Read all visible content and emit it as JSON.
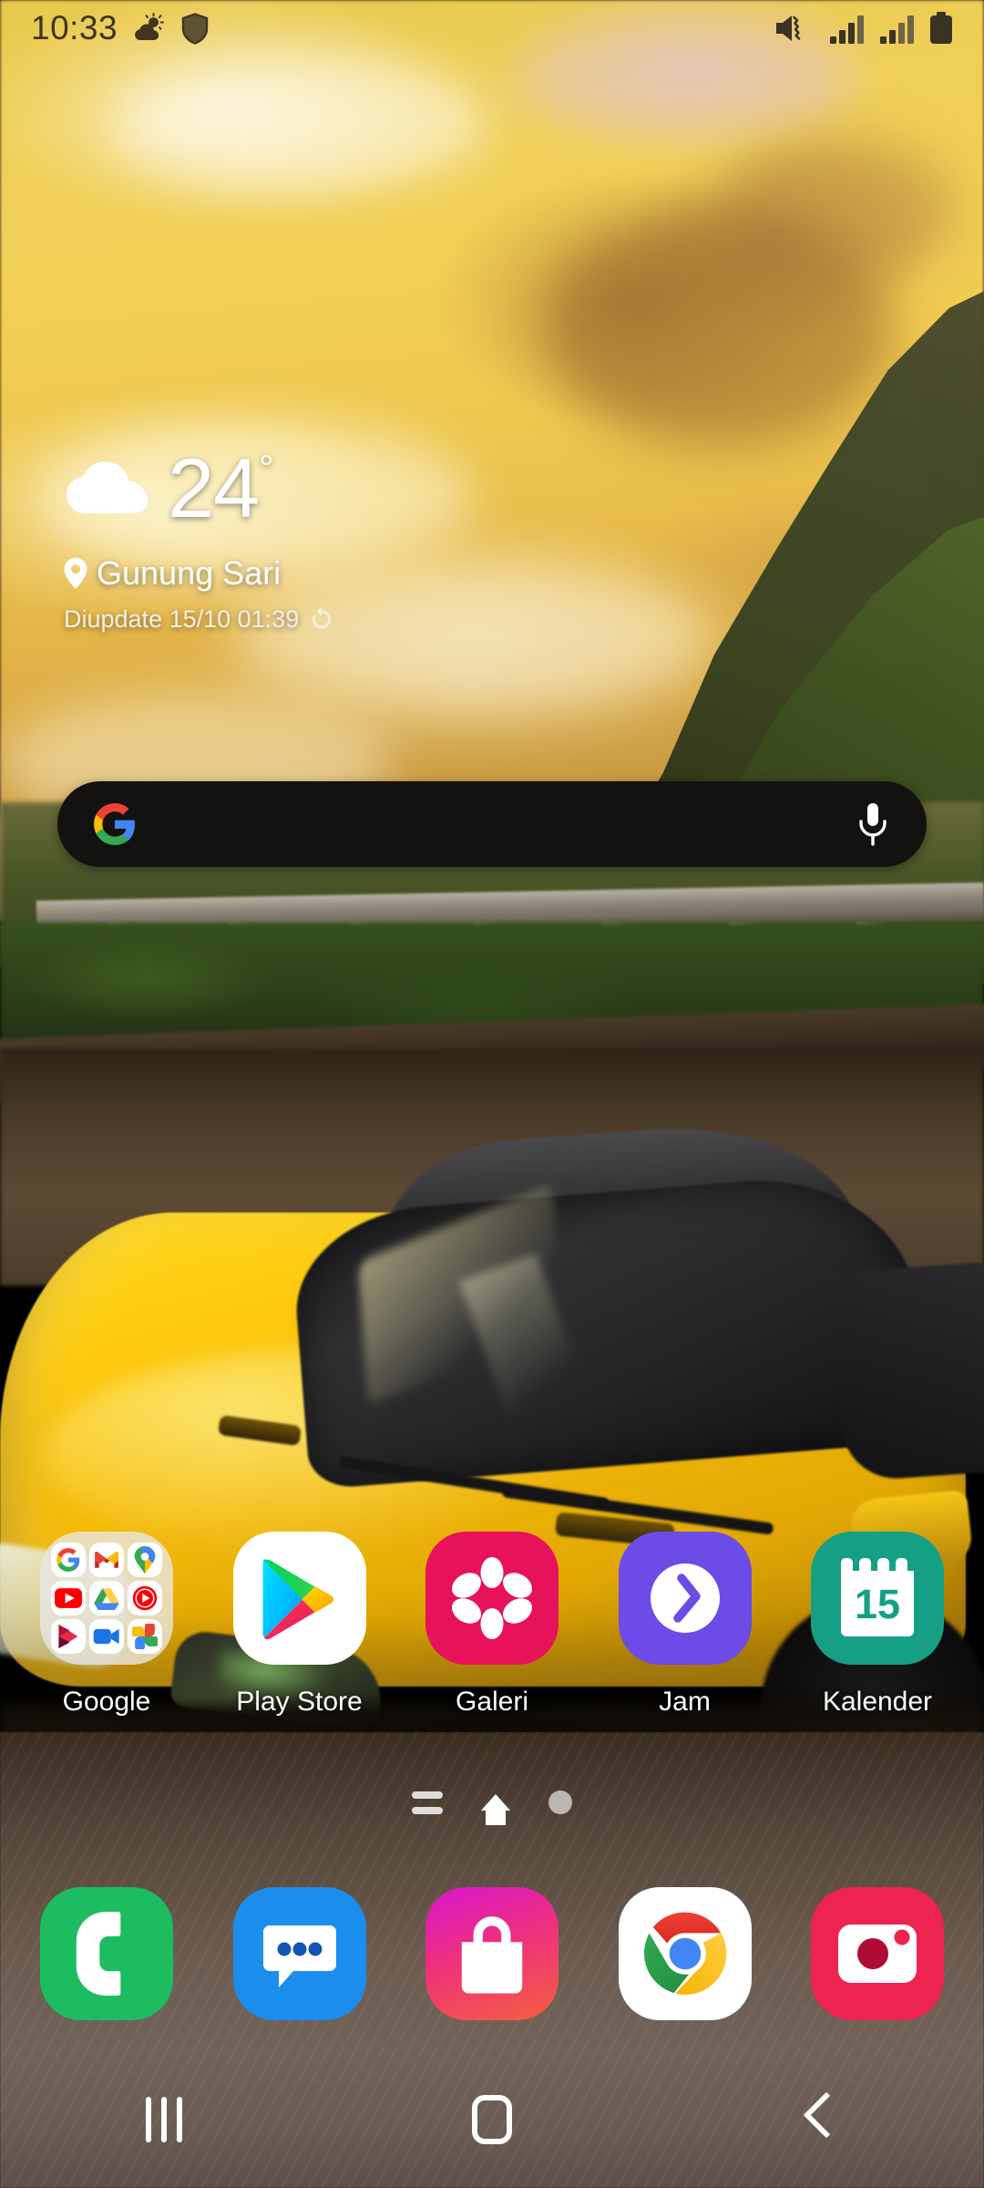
{
  "status_bar": {
    "time": "10:33",
    "left_icons": [
      "weather-partly-cloudy-icon",
      "security-shield-icon"
    ],
    "right_icons": [
      "mute-vibrate-icon",
      "signal-sim1-icon",
      "signal-sim2-icon",
      "battery-icon"
    ]
  },
  "weather_widget": {
    "condition_icon": "cloud-icon",
    "temperature": "24",
    "degree_symbol": "°",
    "location": "Gunung Sari",
    "updated": "Diupdate 15/10 01:39",
    "refresh_icon": "refresh-icon"
  },
  "search_bar": {
    "logo": "google-g-icon",
    "mic_icon": "microphone-icon",
    "query": ""
  },
  "app_grid": [
    {
      "label": "Google",
      "type": "folder",
      "icon": "google-folder",
      "folder_apps": [
        "google-icon",
        "gmail-icon",
        "maps-icon",
        "youtube-icon",
        "drive-icon",
        "youtube-music-icon",
        "play-movies-icon",
        "meet-icon",
        "photos-icon"
      ]
    },
    {
      "label": "Play Store",
      "type": "app",
      "icon": "play-store-icon"
    },
    {
      "label": "Galeri",
      "type": "app",
      "icon": "gallery-flower-icon"
    },
    {
      "label": "Jam",
      "type": "app",
      "icon": "clock-icon"
    },
    {
      "label": "Kalender",
      "type": "app",
      "icon": "calendar-icon",
      "day_number": "15"
    }
  ],
  "page_indicator": {
    "items": [
      "samsung-free-bars",
      "home-page-active",
      "page-dot"
    ],
    "active_index": 1
  },
  "dock": [
    {
      "label": "Phone",
      "icon": "phone-icon"
    },
    {
      "label": "Messages",
      "icon": "messages-icon"
    },
    {
      "label": "Galaxy Store",
      "icon": "galaxy-store-bag-icon"
    },
    {
      "label": "Chrome",
      "icon": "chrome-icon"
    },
    {
      "label": "Camera",
      "icon": "camera-icon"
    }
  ],
  "nav_bar": [
    {
      "label": "Recents",
      "icon": "recents-icon"
    },
    {
      "label": "Home",
      "icon": "home-icon"
    },
    {
      "label": "Back",
      "icon": "back-icon"
    }
  ],
  "wallpaper": {
    "description": "Yellow Lamborghini sports car on a road at golden-hour sunset with mountain and viaduct",
    "sky_color": "#efc74f",
    "car_color": "#fdc90d",
    "road_color": "#6b5b4e"
  },
  "colors": {
    "search_bar_bg": "#141210",
    "galeri": "#e8115b",
    "jam": "#6c4be6",
    "kalender": "#15a086",
    "phone": "#1cbd60",
    "messages": "#1a8ded",
    "camera": "#ed2350"
  }
}
